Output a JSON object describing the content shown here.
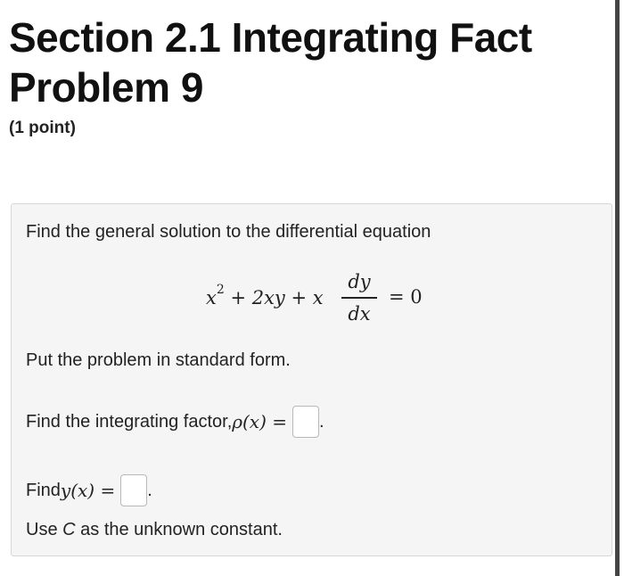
{
  "header": {
    "title_line1": "Section 2.1 Integrating Fact",
    "title_line2": "Problem 9",
    "points": "(1 point)"
  },
  "problem": {
    "intro": "Find the general solution to the differential equation",
    "equation": {
      "left_x": "x",
      "left_exp": "2",
      "left_rest": " + 2xy + x",
      "frac_num": "dy",
      "frac_den": "dx",
      "right": "= 0"
    },
    "standard_form": "Put the problem in standard form.",
    "integrating_factor_prefix": "Find the integrating factor, ",
    "integrating_factor_math": "ρ(x) =",
    "integrating_factor_suffix": ".",
    "find_y_prefix": "Find ",
    "find_y_math": "y(x) =",
    "find_y_suffix": ".",
    "constant_note_prefix": "Use ",
    "constant_note_var": "C",
    "constant_note_suffix": " as the unknown constant."
  }
}
